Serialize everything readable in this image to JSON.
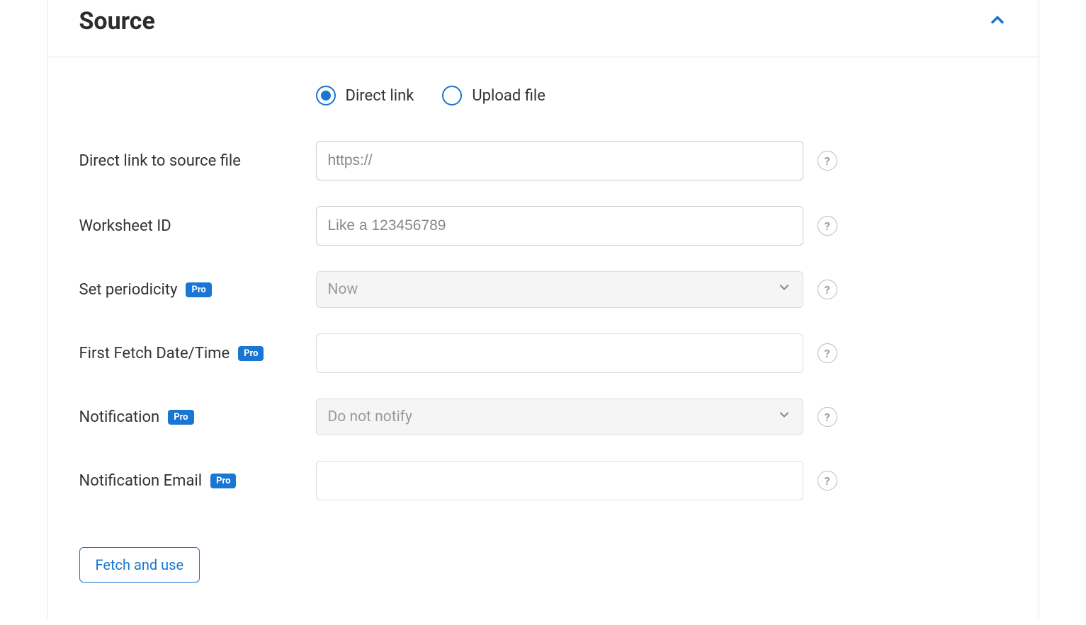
{
  "section": {
    "title": "Source"
  },
  "radios": {
    "direct_link": "Direct link",
    "upload_file": "Upload file"
  },
  "fields": {
    "direct_link": {
      "label": "Direct link to source file",
      "placeholder": "https://",
      "value": ""
    },
    "worksheet_id": {
      "label": "Worksheet ID",
      "placeholder": "Like a 123456789",
      "value": ""
    },
    "periodicity": {
      "label": "Set periodicity",
      "selected": "Now"
    },
    "first_fetch": {
      "label": "First Fetch Date/Time",
      "value": ""
    },
    "notification": {
      "label": "Notification",
      "selected": "Do not notify"
    },
    "notification_email": {
      "label": "Notification Email",
      "value": ""
    }
  },
  "badges": {
    "pro": "Pro"
  },
  "buttons": {
    "fetch": "Fetch and use"
  },
  "help": "?"
}
